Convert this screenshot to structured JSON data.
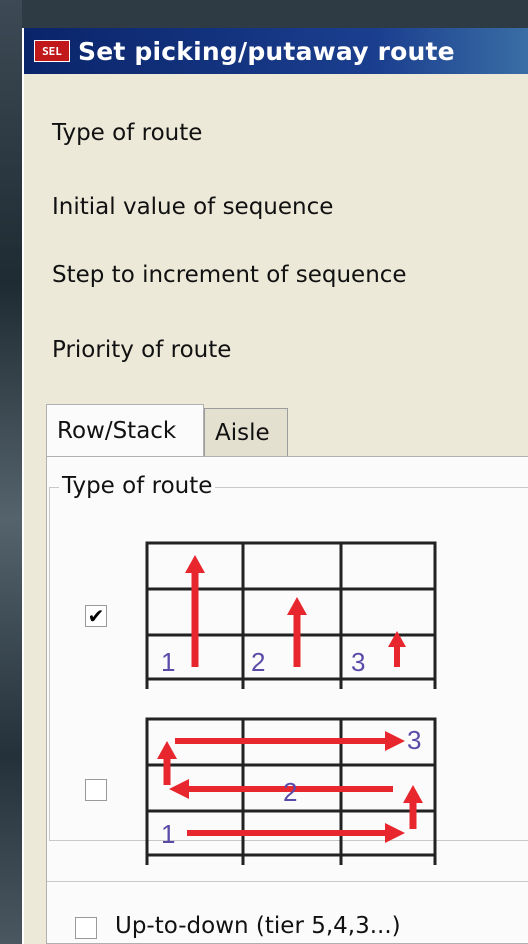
{
  "window": {
    "title": "Set picking/putaway route",
    "icon_text": "SEL"
  },
  "fields": [
    {
      "label": "Type of route"
    },
    {
      "label": "Initial value of sequence"
    },
    {
      "label": "Step to increment of sequence"
    },
    {
      "label": "Priority of route"
    }
  ],
  "tabs": [
    {
      "label": "Row/Stack",
      "active": true
    },
    {
      "label": "Aisle",
      "active": false
    }
  ],
  "route_group": {
    "legend": "Type of route",
    "options": [
      {
        "checked": true,
        "diagram": "row-stack-vertical",
        "numbers": [
          "1",
          "2",
          "3"
        ]
      },
      {
        "checked": false,
        "diagram": "row-stack-serpentine",
        "numbers": [
          "1",
          "2",
          "3"
        ]
      }
    ]
  },
  "up_to_down": {
    "checked": false,
    "label": "Up-to-down (tier 5,4,3...)"
  },
  "colors": {
    "title_bar": "#0a246a",
    "arrow": "#e8262d",
    "number": "#5b4aa8",
    "grid": "#222222"
  },
  "check_glyph": "✔"
}
